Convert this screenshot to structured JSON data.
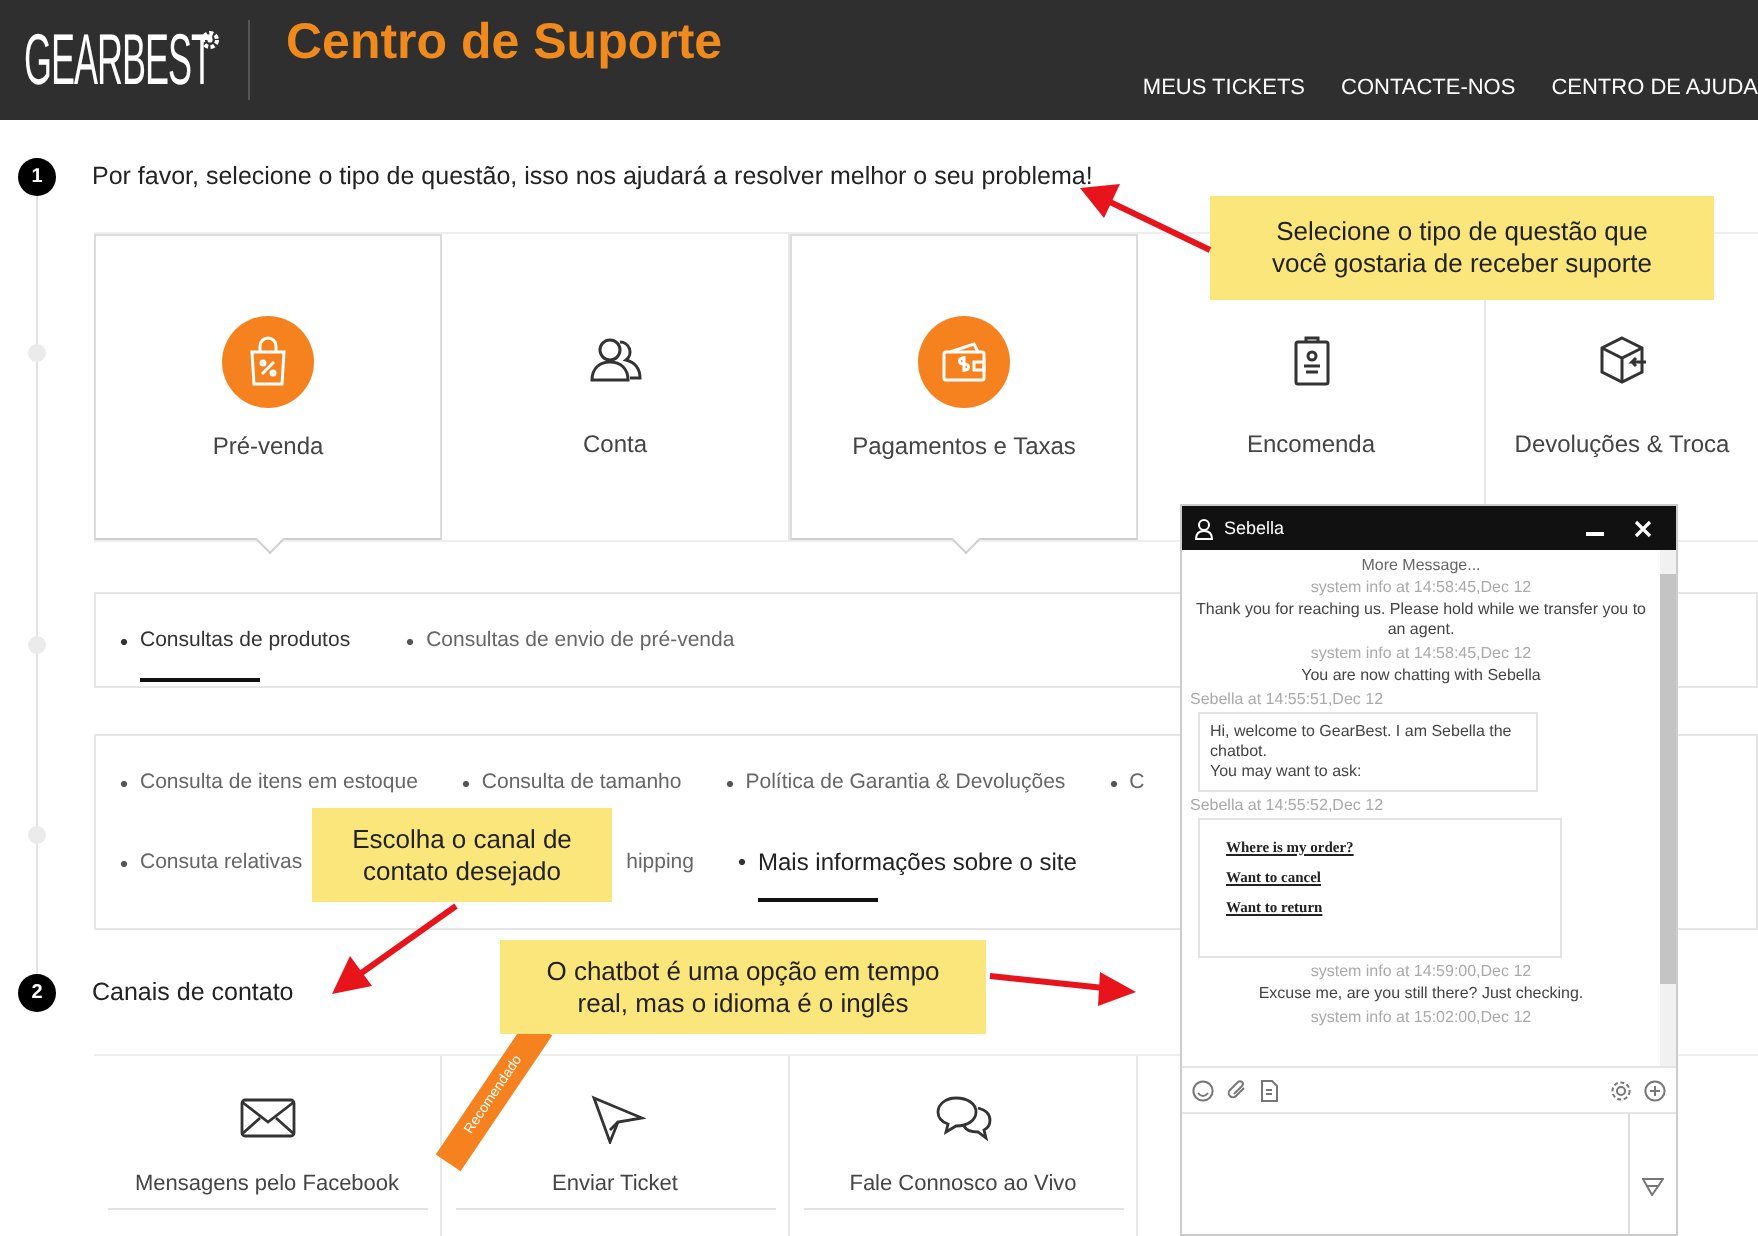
{
  "header": {
    "logo": "GEARBEST",
    "title": "Centro de Suporte",
    "nav": [
      "MEUS TICKETS",
      "CONTACTE-NOS",
      "CENTRO DE AJUDA"
    ]
  },
  "step1": {
    "number": "1",
    "text": "Por favor, selecione o tipo de questão, isso nos ajudará a resolver melhor o seu problema!"
  },
  "categories": [
    {
      "label": "Pré-venda",
      "selected": true
    },
    {
      "label": "Conta",
      "selected": false
    },
    {
      "label": "Pagamentos e Taxas",
      "selected": true
    },
    {
      "label": "Encomenda",
      "selected": false
    },
    {
      "label": "Devoluções & Troca",
      "selected": false
    }
  ],
  "subcategories": [
    {
      "label": "Consultas de produtos",
      "selected": true
    },
    {
      "label": "Consultas de envio de pré-venda",
      "selected": false
    }
  ],
  "more_subcategories": [
    [
      {
        "label": "Consulta de itens em estoque",
        "selected": false,
        "bullet": true
      },
      {
        "label": "Consulta de tamanho",
        "selected": false,
        "bullet": true
      },
      {
        "label": "Política de Garantia & Devoluções",
        "selected": false,
        "bullet": true
      },
      {
        "label": "C",
        "selected": false,
        "bullet": true
      }
    ],
    [
      {
        "label": "Consuta relativas",
        "selected": false,
        "bullet": true
      },
      {
        "label": "hipping",
        "selected": false,
        "bullet": false
      },
      {
        "label": "Mais informações sobre o site",
        "selected": true,
        "bullet": true
      }
    ]
  ],
  "step2": {
    "number": "2",
    "text": "Canais de contato"
  },
  "channels": [
    {
      "label": "Mensagens pelo Facebook"
    },
    {
      "label": "Enviar Ticket"
    },
    {
      "label": "Fale Connosco ao Vivo"
    }
  ],
  "ribbon": "Recomendado",
  "chat": {
    "agent": "Sebella",
    "more": "More Message...",
    "messages": [
      {
        "kind": "meta",
        "text": "system info at 14:58:45,Dec 12"
      },
      {
        "kind": "notice",
        "text": "Thank you for reaching us. Please hold while we transfer you to an agent."
      },
      {
        "kind": "meta",
        "text": "system info at 14:58:45,Dec 12"
      },
      {
        "kind": "notice",
        "text": "You are now chatting with Sebella"
      },
      {
        "kind": "sender",
        "text": "Sebella at 14:55:51,Dec 12"
      },
      {
        "kind": "bubble",
        "text": "Hi, welcome to GearBest.  I am Sebella the chatbot.\nYou may want to ask:"
      },
      {
        "kind": "sender",
        "text": "Sebella at 14:55:52,Dec 12"
      },
      {
        "kind": "links",
        "links": [
          "Where is my order?",
          "Want to cancel",
          "Want to return"
        ]
      },
      {
        "kind": "meta",
        "text": "system info at 14:59:00,Dec 12"
      },
      {
        "kind": "notice",
        "text": "Excuse me, are you still there? Just checking."
      },
      {
        "kind": "meta",
        "text": "system info at 15:02:00,Dec 12"
      }
    ]
  },
  "callouts": [
    {
      "text": "Selecione o tipo de questão que você gostaria de receber suporte"
    },
    {
      "text": "Escolha o canal de contato desejado"
    },
    {
      "text": "O chatbot é uma opção em tempo real, mas o idioma é o inglês"
    }
  ]
}
